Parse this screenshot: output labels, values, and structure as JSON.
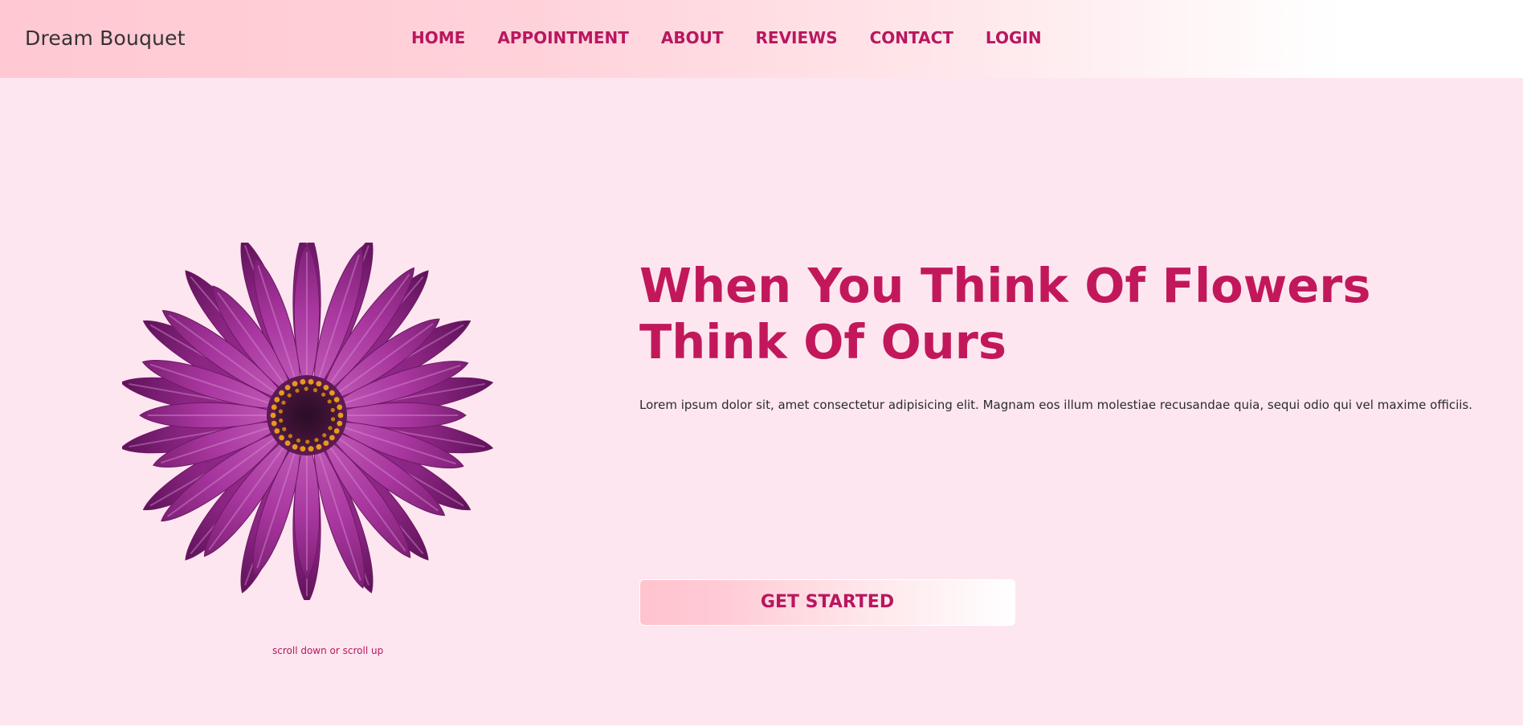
{
  "header": {
    "brand": "Dream Bouquet",
    "nav": [
      {
        "label": "HOME"
      },
      {
        "label": "APPOINTMENT"
      },
      {
        "label": "ABOUT"
      },
      {
        "label": "REVIEWS"
      },
      {
        "label": "CONTACT"
      },
      {
        "label": "LOGIN"
      }
    ]
  },
  "hero": {
    "headline_line1": "When You Think Of Flowers",
    "headline_line2": "Think Of Ours",
    "lead": "Lorem ipsum dolor sit, amet consectetur adipisicing elit. Magnam eos illum molestiae recusandae quia, sequi odio qui vel maxime officiis.",
    "cta_label": "GET STARTED",
    "scroll_hint": "scroll down or scroll up"
  },
  "colors": {
    "accent": "#c2185b",
    "nav_text": "#b8175f",
    "hero_background": "#fde6ef",
    "header_gradient_start": "#ffc8d2",
    "flower_petal": "#a8379f"
  },
  "icons": {
    "hero_image": "purple-daisy-flower"
  }
}
